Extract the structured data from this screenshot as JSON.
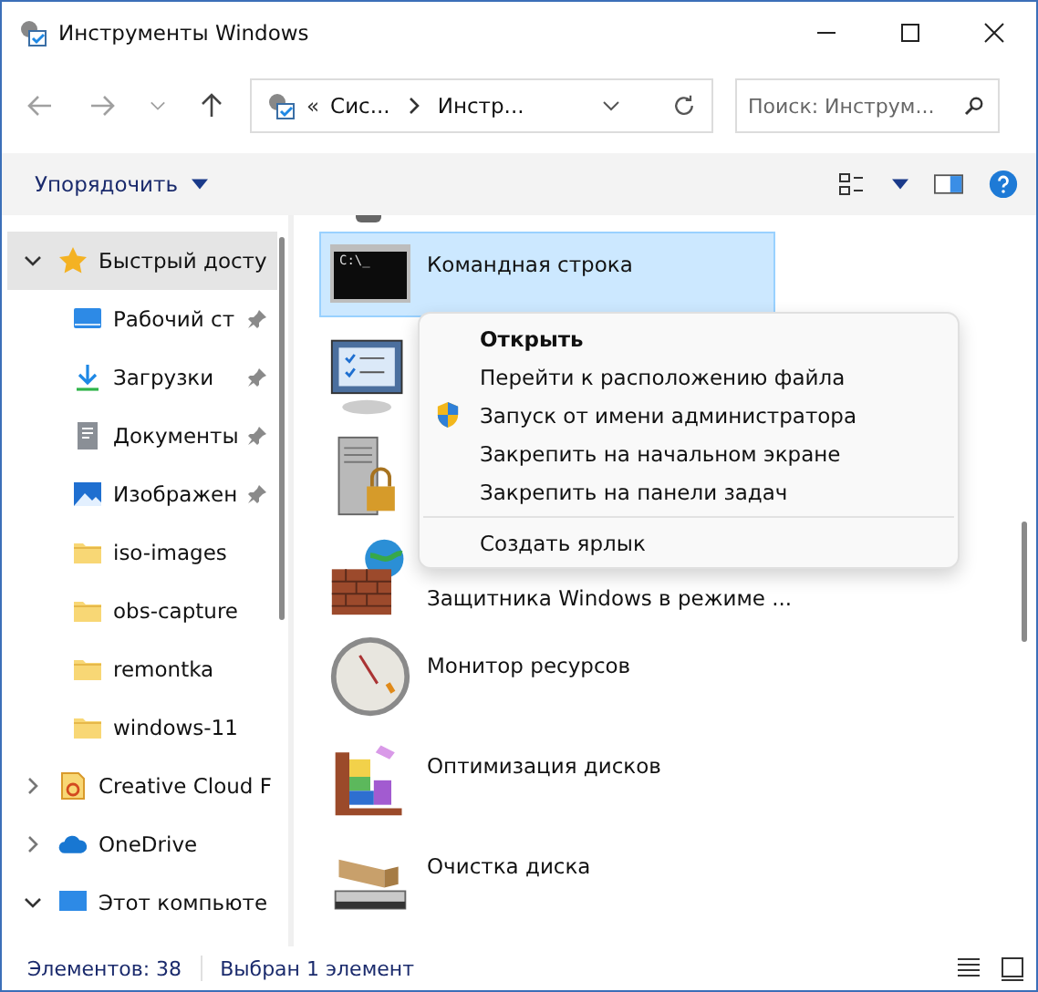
{
  "window": {
    "title": "Инструменты Windows"
  },
  "address": {
    "overflow": "«",
    "segments": [
      "Сис...",
      "Инстр..."
    ]
  },
  "search": {
    "placeholder": "Поиск: Инструм..."
  },
  "toolbar": {
    "organize": "Упорядочить"
  },
  "sidebar": {
    "items": [
      {
        "label": "Быстрый досту",
        "expanded": true,
        "selected": true,
        "children": [
          {
            "label": "Рабочий ст",
            "pinned": true,
            "selected": false
          },
          {
            "label": "Загрузки",
            "pinned": true,
            "selected": false
          },
          {
            "label": "Документы",
            "pinned": true,
            "selected": false
          },
          {
            "label": "Изображен",
            "pinned": true,
            "selected": false
          },
          {
            "label": "iso-images",
            "pinned": false,
            "selected": false
          },
          {
            "label": "obs-capture",
            "pinned": false,
            "selected": false
          },
          {
            "label": "remontka",
            "pinned": false,
            "selected": false
          },
          {
            "label": "windows-11",
            "pinned": false,
            "selected": false
          }
        ]
      },
      {
        "label": "Creative Cloud F",
        "expanded": false,
        "selected": false
      },
      {
        "label": "OneDrive",
        "expanded": false,
        "selected": false
      },
      {
        "label": "Этот компьюте",
        "expanded": true,
        "selected": false
      }
    ]
  },
  "files": [
    {
      "label": "Командная строка",
      "screen_text": "C:\\_",
      "selected": true
    },
    {
      "selected": false
    },
    {
      "selected": false
    },
    {
      "label": "Защитника Windows в режиме ...",
      "selected": false
    },
    {
      "label": "Монитор ресурсов",
      "selected": false
    },
    {
      "label": "Оптимизация дисков",
      "selected": false
    },
    {
      "label": "Очистка диска",
      "selected": false
    }
  ],
  "context_menu": {
    "items": [
      {
        "kind": "default",
        "label": "Открыть"
      },
      {
        "kind": "item",
        "label": "Перейти к расположению файла"
      },
      {
        "kind": "shield",
        "label": "Запуск от имени администратора"
      },
      {
        "kind": "item",
        "label": "Закрепить на начальном экране"
      },
      {
        "kind": "item",
        "label": "Закрепить на панели задач"
      },
      {
        "kind": "separator"
      },
      {
        "kind": "item",
        "label": "Создать ярлык"
      }
    ]
  },
  "status_bar": {
    "count": "Элементов: 38",
    "selection": "Выбран 1 элемент"
  }
}
